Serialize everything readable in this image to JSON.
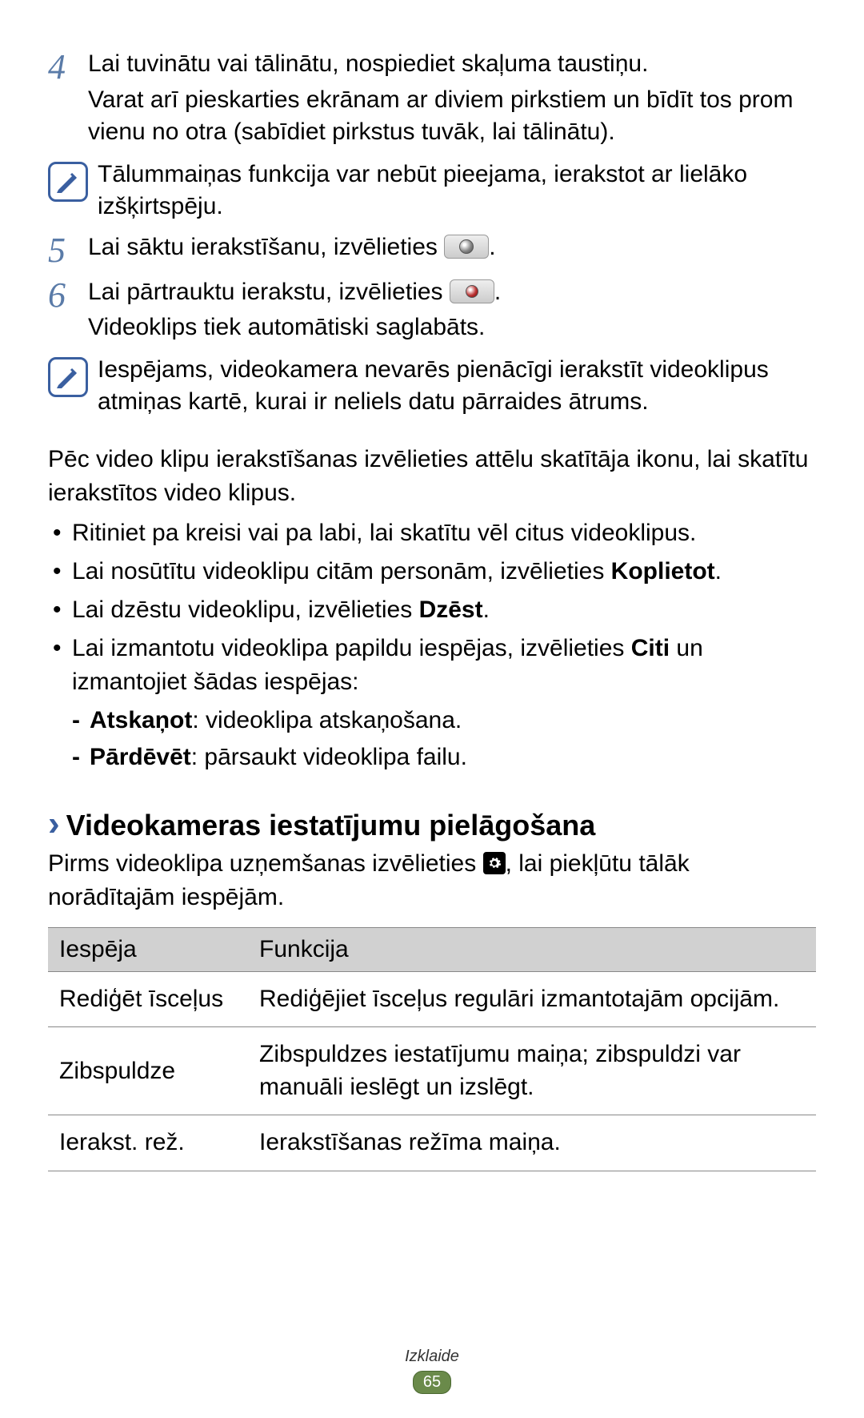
{
  "steps": {
    "s4": {
      "num": "4",
      "line1": "Lai tuvinātu vai tālinātu, nospiediet skaļuma taustiņu.",
      "line2": "Varat arī pieskarties ekrānam ar diviem pirkstiem un bīdīt tos prom vienu no otra (sabīdiet pirkstus tuvāk, lai tālinātu)."
    },
    "note1": "Tālummaiņas funkcija var nebūt pieejama, ierakstot ar lielāko izšķirtspēju.",
    "s5": {
      "num": "5",
      "pre": "Lai sāktu ierakstīšanu, izvēlieties ",
      "post": "."
    },
    "s6": {
      "num": "6",
      "pre": "Lai pārtrauktu ierakstu, izvēlieties ",
      "post": ".",
      "line2": "Videoklips tiek automātiski saglabāts."
    },
    "note2": "Iespējams, videokamera nevarēs pienācīgi ierakstīt videoklipus atmiņas kartē, kurai ir neliels datu pārraides ātrums."
  },
  "after_steps": "Pēc video klipu ierakstīšanas izvēlieties attēlu skatītāja ikonu, lai skatītu ierakstītos video klipus.",
  "bullets": {
    "b1": "Ritiniet pa kreisi vai pa labi, lai skatītu vēl citus videoklipus.",
    "b2_pre": "Lai nosūtītu videoklipu citām personām, izvēlieties ",
    "b2_bold": "Koplietot",
    "b2_post": ".",
    "b3_pre": "Lai dzēstu videoklipu, izvēlieties ",
    "b3_bold": "Dzēst",
    "b3_post": ".",
    "b4_pre": "Lai izmantotu videoklipa papildu iespējas, izvēlieties ",
    "b4_bold": "Citi",
    "b4_post": " un izmantojiet šādas iespējas:",
    "sub1_bold": "Atskaņot",
    "sub1_rest": ": videoklipa atskaņošana.",
    "sub2_bold": "Pārdēvēt",
    "sub2_rest": ": pārsaukt videoklipa failu."
  },
  "subheading": "Videokameras iestatījumu pielāgošana",
  "sub_intro_pre": "Pirms videoklipa uzņemšanas izvēlieties ",
  "sub_intro_post": ", lai piekļūtu tālāk norādītajām iespējām.",
  "table": {
    "h1": "Iespēja",
    "h2": "Funkcija",
    "rows": [
      {
        "opt": "Rediģēt īsceļus",
        "fn": "Rediģējiet īsceļus regulāri izmantotajām opcijām."
      },
      {
        "opt": "Zibspuldze",
        "fn": "Zibspuldzes iestatījumu maiņa; zibspuldzi var manuāli ieslēgt un izslēgt."
      },
      {
        "opt": "Ierakst. rež.",
        "fn": "Ierakstīšanas režīma maiņa."
      }
    ]
  },
  "footer": {
    "section": "Izklaide",
    "page": "65"
  }
}
